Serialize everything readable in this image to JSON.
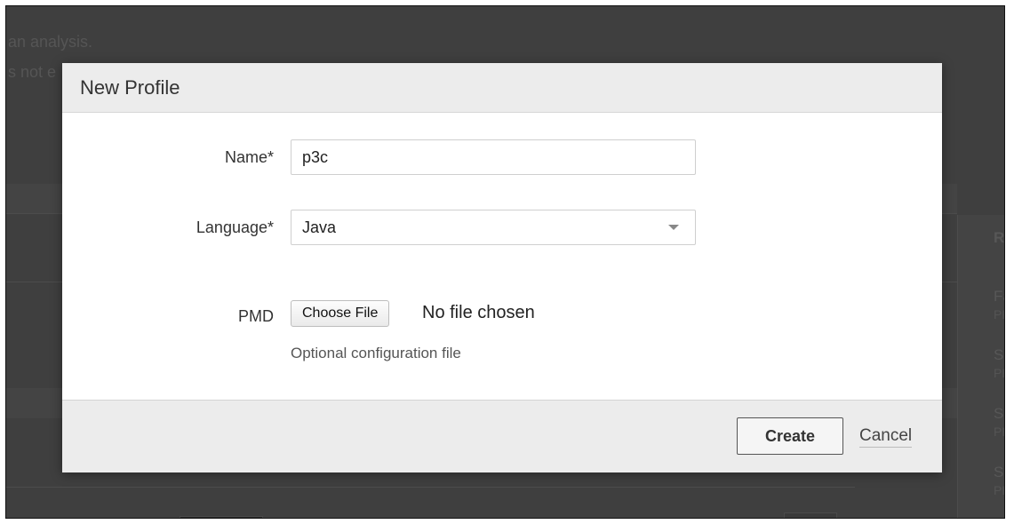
{
  "background": {
    "line1": "an analysis.",
    "line2": "s not e",
    "right_panel": {
      "heading": "Re",
      "items": [
        {
          "title": "Fa",
          "sub": "PH"
        },
        {
          "title": "Sk",
          "sub": "PH"
        },
        {
          "title": "Sc",
          "sub": "PH"
        },
        {
          "title": "Sc",
          "sub": "PH"
        }
      ]
    }
  },
  "modal": {
    "title": "New Profile",
    "fields": {
      "name": {
        "label": "Name*",
        "value": "p3c"
      },
      "language": {
        "label": "Language*",
        "value": "Java"
      },
      "pmd": {
        "label": "PMD",
        "button_label": "Choose File",
        "status": "No file chosen",
        "help": "Optional configuration file"
      }
    },
    "footer": {
      "create_label": "Create",
      "cancel_label": "Cancel"
    }
  },
  "colors": {
    "overlay": "#3f3f3f",
    "modal_header": "#ececec",
    "modal_body": "#ffffff"
  }
}
